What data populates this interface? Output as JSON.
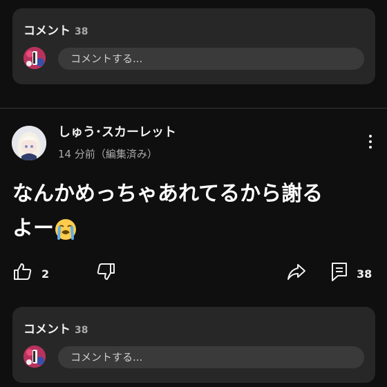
{
  "comments_top": {
    "title": "コメント",
    "count": "38",
    "placeholder": "コメントする..."
  },
  "post": {
    "author": "しゅう･スカーレット",
    "meta": "14 分前（編集済み）",
    "text_line1": "なんかめっちゃあれてるから謝る",
    "text_line2": "よー",
    "emoji": "loudly-crying-face"
  },
  "actions": {
    "like_count": "2",
    "reply_count": "38"
  },
  "comments_bottom": {
    "title": "コメント",
    "count": "38",
    "placeholder": "コメントする..."
  },
  "colors": {
    "background": "#0f0f0f",
    "card": "#272727",
    "input": "#3a3a3a",
    "text": "#f1f1f1",
    "muted": "#aaaaaa"
  }
}
